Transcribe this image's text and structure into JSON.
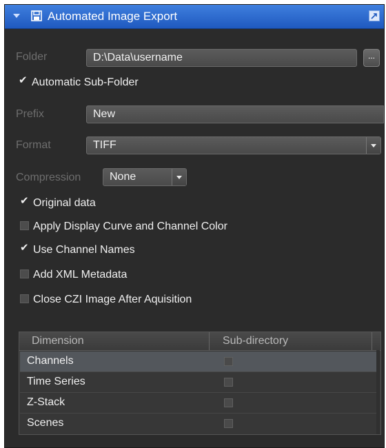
{
  "title": "Automated Image Export",
  "folder": {
    "label": "Folder",
    "value": "D:\\Data\\username",
    "browse_label": "..."
  },
  "auto_subfolder": {
    "label": "Automatic Sub-Folder",
    "checked": true
  },
  "prefix": {
    "label": "Prefix",
    "value": "New"
  },
  "format": {
    "label": "Format",
    "value": "TIFF"
  },
  "compression": {
    "label": "Compression",
    "value": "None"
  },
  "options": [
    {
      "label": "Original data",
      "checked": true
    },
    {
      "label": "Apply Display Curve and Channel Color",
      "checked": false
    },
    {
      "label": "Use Channel Names",
      "checked": true
    },
    {
      "label": "Add XML Metadata",
      "checked": false
    },
    {
      "label": "Close CZI Image After Aquisition",
      "checked": false
    }
  ],
  "table": {
    "headers": [
      "Dimension",
      "Sub-directory"
    ],
    "rows": [
      {
        "dimension": "Channels",
        "subdirectory": false,
        "selected": true
      },
      {
        "dimension": "Time Series",
        "subdirectory": false,
        "selected": false
      },
      {
        "dimension": "Z-Stack",
        "subdirectory": false,
        "selected": false
      },
      {
        "dimension": "Scenes",
        "subdirectory": false,
        "selected": false
      }
    ]
  },
  "colors": {
    "titlebar": "#2f6fd6",
    "panel_bg": "#2b2b2b",
    "text": "#f0f0f0",
    "muted_label": "#6e6e6e"
  },
  "icons": {
    "collapse": "chevron-down-icon",
    "title": "save-disk-icon",
    "undock": "undock-icon"
  }
}
